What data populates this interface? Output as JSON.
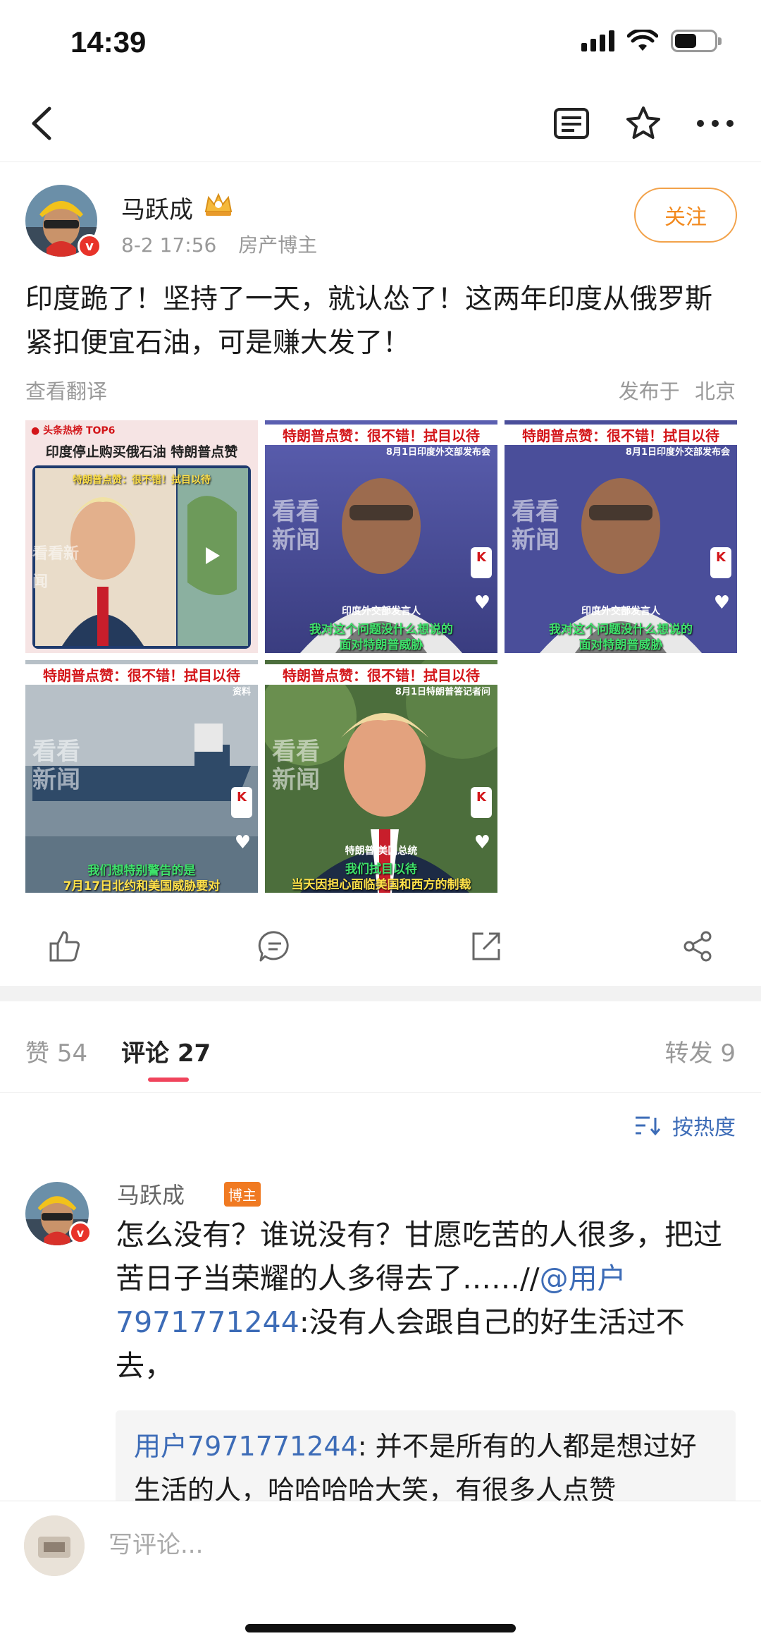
{
  "status_bar": {
    "time": "14:39"
  },
  "author": {
    "name": "马跃成",
    "timestamp": "8-2 17:56",
    "role": "房产博主",
    "verified_mark": "v",
    "follow_label": "关注"
  },
  "post": {
    "text": "印度跪了！坚持了一天，就认怂了！这两年印度从俄罗斯紧扣便宜石油，可是赚大发了！",
    "translate_label": "查看翻译",
    "location_prefix": "发布于",
    "location": "北京"
  },
  "images": [
    {
      "caption_top": "印度停止购买俄石油 特朗普点赞",
      "caption_mid": "特朗普点赞：很不错！拭目以待",
      "watermark": "看看新闻"
    },
    {
      "caption_top": "特朗普点赞：很不错！拭目以待",
      "caption_sub": "8月1日印度外交部发布会",
      "speaker": "印度外交部发言人",
      "subtitle": "我对这个问题没什么想说的",
      "subtitle2": "面对特朗普威胁",
      "watermark": "看看新闻"
    },
    {
      "caption_top": "特朗普点赞：很不错！拭目以待",
      "caption_sub": "8月1日印度外交部发布会",
      "speaker": "印度外交部发言人",
      "subtitle": "我对这个问题没什么想说的",
      "subtitle2": "面对特朗普威胁",
      "watermark": "看看新闻"
    },
    {
      "caption_top": "特朗普点赞：很不错！拭目以待",
      "caption_sub": "资料",
      "subtitle": "我们想特别警告的是",
      "subtitle2": "7月17日北约和美国威胁要对",
      "watermark": "看看新闻"
    },
    {
      "caption_top": "特朗普点赞：很不错！拭目以待",
      "caption_sub": "8月1日特朗普答记者问",
      "speaker": "特朗普 美国总统",
      "subtitle": "我们拭目以待",
      "subtitle2": "当天因担心面临美国和西方的制裁",
      "watermark": "看看新闻"
    }
  ],
  "tabs": {
    "likes_label": "赞",
    "likes_count": "54",
    "comments_label": "评论",
    "comments_count": "27",
    "reposts_label": "转发",
    "reposts_count": "9"
  },
  "sort": {
    "label": "按热度"
  },
  "comment": {
    "name": "马跃成",
    "tag": "博主",
    "text_main": "怎么没有？谁说没有？甘愿吃苦的人很多，把过苦日子当荣耀的人多得去了……//",
    "mention": "@用户7971771244",
    "text_tail": ":没有人会跟自己的好生活过不去，",
    "quote_user": "用户7971771244",
    "quote_text": ": 并不是所有的人都是想过好生活的人，哈哈哈哈大笑，有很多人点赞"
  },
  "input": {
    "placeholder": "写评论..."
  },
  "colors": {
    "accent": "#f0445c",
    "follow": "#f28a1f",
    "link": "#3d6cb7",
    "verified": "#e8332a"
  }
}
